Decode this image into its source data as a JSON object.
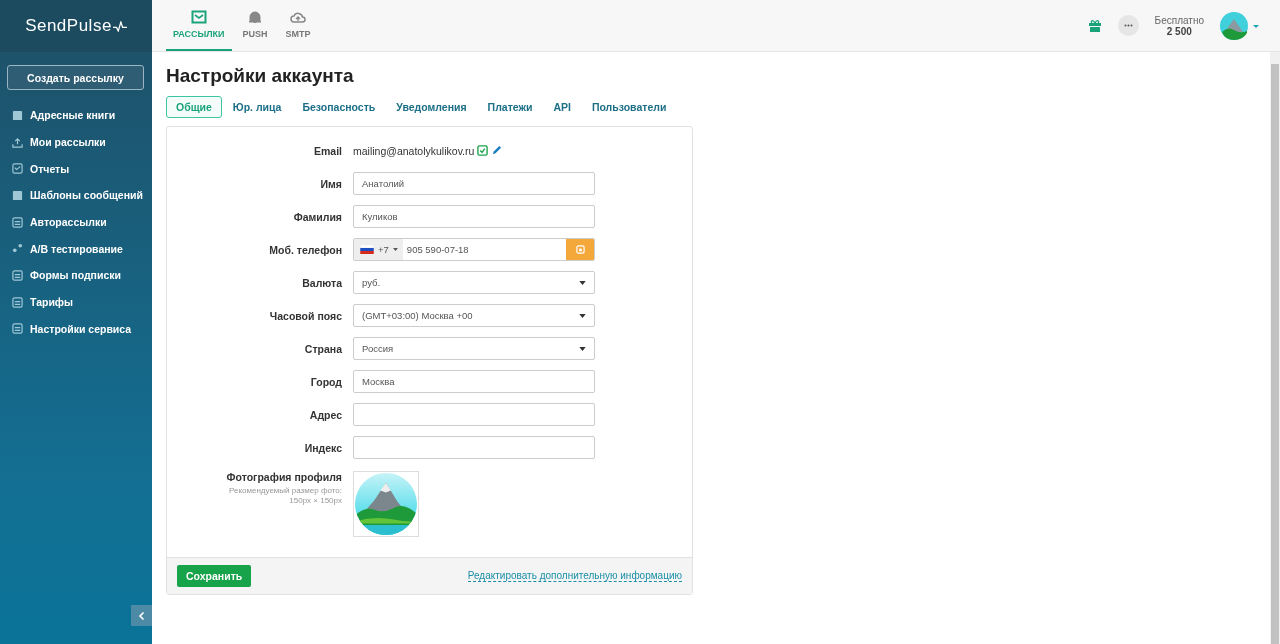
{
  "logo": {
    "text": "SendPulse"
  },
  "sidebar": {
    "create_button": "Создать рассылку",
    "items": [
      {
        "label": "Адресные книги"
      },
      {
        "label": "Мои рассылки"
      },
      {
        "label": "Отчеты"
      },
      {
        "label": "Шаблоны сообщений"
      },
      {
        "label": "Авторассылки"
      },
      {
        "label": "A/B тестирование"
      },
      {
        "label": "Формы подписки"
      },
      {
        "label": "Тарифы"
      },
      {
        "label": "Настройки сервиса"
      }
    ]
  },
  "top_nav": [
    {
      "label": "РАССЫЛКИ",
      "selected": true
    },
    {
      "label": "PUSH",
      "selected": false
    },
    {
      "label": "SMTP",
      "selected": false
    }
  ],
  "plan": {
    "name": "Бесплатно",
    "count": "2 500"
  },
  "page_title": "Настройки аккаунта",
  "tabs": [
    {
      "label": "Общие",
      "selected": true
    },
    {
      "label": "Юр. лица",
      "selected": false
    },
    {
      "label": "Безопасность",
      "selected": false
    },
    {
      "label": "Уведомления",
      "selected": false
    },
    {
      "label": "Платежи",
      "selected": false
    },
    {
      "label": "API",
      "selected": false
    },
    {
      "label": "Пользователи",
      "selected": false
    }
  ],
  "form": {
    "rows": [
      {
        "label": "Email",
        "kind": "static",
        "value": "mailing@anatolykulikov.ru",
        "verified": true
      },
      {
        "label": "Имя",
        "kind": "input",
        "value": "Анатолий"
      },
      {
        "label": "Фамилия",
        "kind": "input",
        "value": "Куликов"
      },
      {
        "label": "Моб. телефон",
        "kind": "phone",
        "code": "+7",
        "value": "905 590-07-18"
      },
      {
        "label": "Валюта",
        "kind": "select",
        "value": "руб."
      },
      {
        "label": "Часовой пояс",
        "kind": "select",
        "value": "(GMT+03:00) Москва +00"
      },
      {
        "label": "Страна",
        "kind": "select",
        "value": "Россия"
      },
      {
        "label": "Город",
        "kind": "input",
        "value": "Москва"
      },
      {
        "label": "Адрес",
        "kind": "input"
      },
      {
        "label": "Индекс",
        "kind": "input"
      },
      {
        "label": "Фотография профиля",
        "kind": "photo",
        "hint": "Рекомендуемый размер фото: 150px × 150px"
      }
    ],
    "save_button": "Сохранить",
    "extra_link": "Редактировать дополнительную информацию"
  }
}
